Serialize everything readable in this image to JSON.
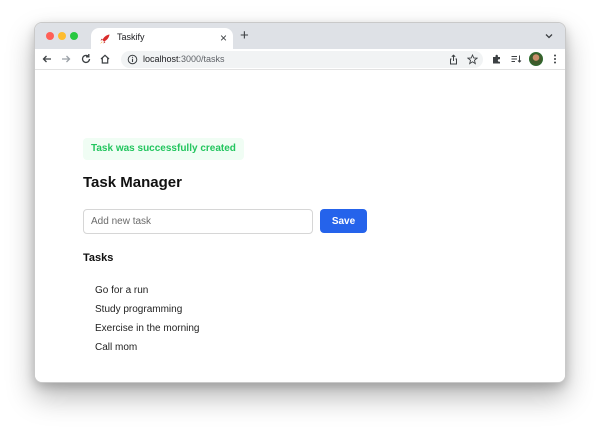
{
  "browser": {
    "tab": {
      "title": "Taskify",
      "favicon": "rocket-icon",
      "close": "×"
    },
    "new_tab": "+",
    "address": {
      "host": "localhost",
      "path": ":3000/tasks"
    },
    "icons": [
      "back-arrow-icon",
      "forward-arrow-icon",
      "reload-icon",
      "home-icon",
      "info-icon",
      "share-icon",
      "star-icon",
      "extensions-icon",
      "reading-list-icon",
      "avatar",
      "menu-icon",
      "tab-search-icon"
    ]
  },
  "page": {
    "alert": "Task was successfully created",
    "title": "Task Manager",
    "input": {
      "placeholder": "Add new task",
      "value": ""
    },
    "save_label": "Save",
    "tasks_heading": "Tasks",
    "tasks": [
      "Go for a run",
      "Study programming",
      "Exercise in the morning",
      "Call mom"
    ]
  },
  "colors": {
    "primary": "#2563eb",
    "success_text": "#22c55e",
    "success_bg": "#f0fdf4"
  }
}
